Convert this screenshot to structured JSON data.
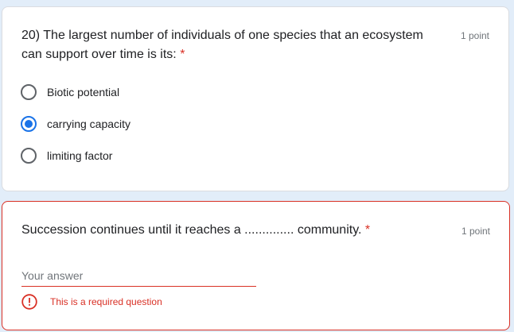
{
  "question1": {
    "title": "20) The largest number of individuals of one species that an ecosystem can support over time is its:",
    "required_mark": "*",
    "points": "1 point",
    "options": [
      {
        "label": "Biotic potential",
        "selected": false
      },
      {
        "label": "carrying capacity",
        "selected": true
      },
      {
        "label": "limiting factor",
        "selected": false
      }
    ]
  },
  "question2": {
    "title": "Succession continues until it reaches a .............. community.",
    "required_mark": "*",
    "points": "1 point",
    "answer_value": "",
    "answer_placeholder": "Your answer",
    "error_icon": "error-circle-icon",
    "error_text": "This is a required question"
  },
  "colors": {
    "background": "#e2edf9",
    "accent": "#1a73e8",
    "error": "#d93025"
  }
}
